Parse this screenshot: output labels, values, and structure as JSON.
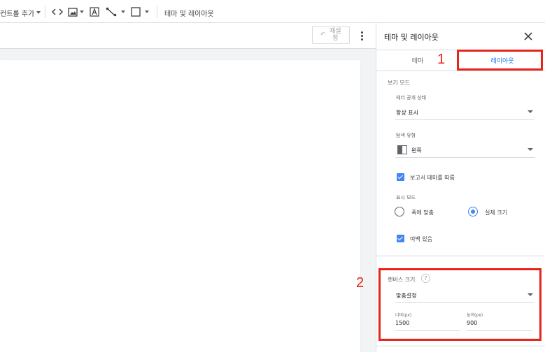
{
  "toolbar": {
    "add_control_label": "컨트롤 추가",
    "theme_layout_label": "테마 및 레이아웃",
    "icons": [
      "code-icon",
      "image-icon",
      "text-icon",
      "line-icon",
      "rectangle-icon"
    ]
  },
  "canvas": {
    "reset_label": "재설정"
  },
  "panel": {
    "title": "테마 및 레이아웃",
    "tabs": [
      {
        "label": "테마"
      },
      {
        "label": "레이아웃"
      }
    ],
    "view_mode": {
      "section_label": "보기 모드",
      "header_visibility_label": "헤더 공개 상태",
      "header_visibility_value": "항상 표시",
      "nav_type_label": "탐색 유형",
      "nav_type_value": "왼쪽",
      "follow_theme_label": "보고서 테마를 따름",
      "display_mode_label": "표시 모드",
      "fit_width_label": "폭에 맞춤",
      "actual_size_label": "실제 크기",
      "margin_label": "여백 있음"
    },
    "canvas_size": {
      "section_label": "캔버스 크기",
      "help": "?",
      "preset_value": "맞춤설정",
      "width_label": "너비(px)",
      "width_value": "1500",
      "height_label": "높이(px)",
      "height_value": "900"
    }
  },
  "annotations": {
    "marker_1": "1",
    "marker_2": "2",
    "color": "#e8231a"
  }
}
